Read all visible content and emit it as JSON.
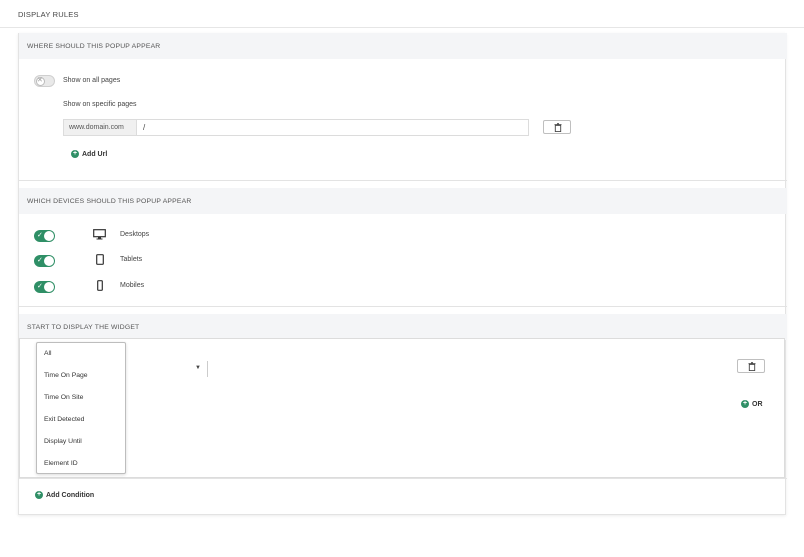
{
  "page": {
    "title": "DISPLAY RULES"
  },
  "sections": {
    "where": {
      "title": "WHERE SHOULD THIS POPUP APPEAR",
      "show_all_label": "Show on all pages",
      "show_all_enabled": false,
      "specific_label": "Show on specific pages",
      "url_prefix": "www.domain.com",
      "url_value": "/",
      "add_url_label": "Add Url"
    },
    "devices": {
      "title": "WHICH DEVICES SHOULD THIS POPUP APPEAR",
      "items": [
        {
          "label": "Desktops",
          "icon": "desktop-icon",
          "enabled": true
        },
        {
          "label": "Tablets",
          "icon": "tablet-icon",
          "enabled": true
        },
        {
          "label": "Mobiles",
          "icon": "mobile-icon",
          "enabled": true
        }
      ]
    },
    "start": {
      "title": "START TO DISPLAY THE WIDGET",
      "dropdown_options": [
        "All",
        "Time On Page",
        "Time On Site",
        "Exit Detected",
        "Display Until",
        "Element ID"
      ],
      "or_label": "OR",
      "add_condition_label": "Add Condition"
    }
  },
  "colors": {
    "accent": "#2f8f66",
    "header_bg": "#f4f5f7",
    "border": "#dcdcdc"
  }
}
